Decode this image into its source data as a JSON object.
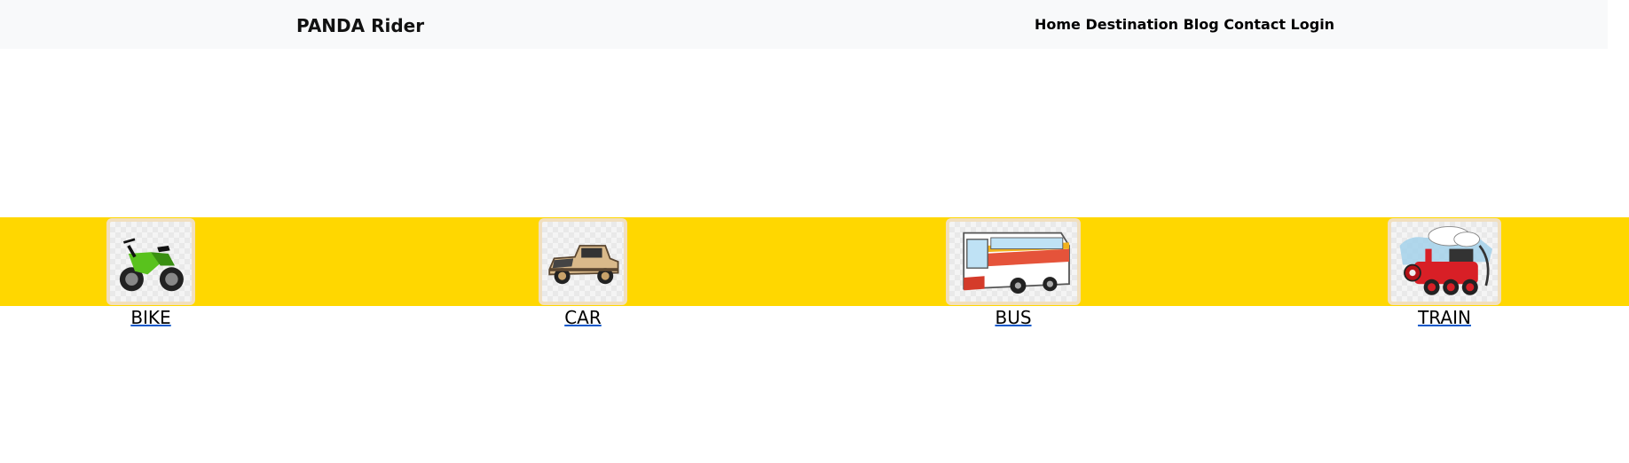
{
  "navbar": {
    "brand": "PANDA Rider",
    "links": [
      "Home",
      "Destination",
      "Blog",
      "Contact",
      "Login"
    ]
  },
  "band_color": "#ffd700",
  "vehicles": [
    {
      "label": "BIKE",
      "icon": "motorbike-icon"
    },
    {
      "label": "CAR",
      "icon": "vintage-car-icon"
    },
    {
      "label": "BUS",
      "icon": "bus-icon"
    },
    {
      "label": "TRAIN",
      "icon": "steam-train-icon"
    }
  ]
}
